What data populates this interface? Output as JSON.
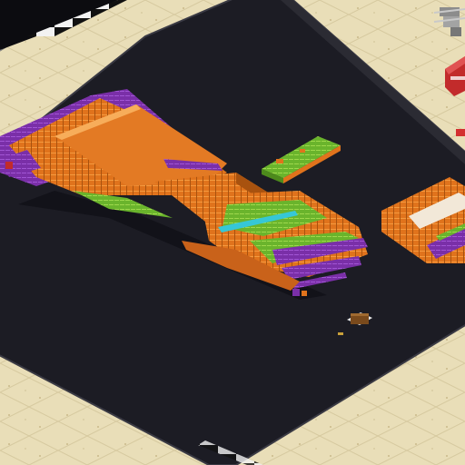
{
  "scene": {
    "view": "isometric",
    "colors": {
      "sand": "#e9deb8",
      "sand_grid": "#cfc298",
      "floor": "#1c1c24",
      "floor_edge": "#3a3a44",
      "orange": "#e0731c",
      "orange_dark": "#a8520f",
      "orange_light": "#f49a3f",
      "purple": "#7a2fa8",
      "green": "#6ab42c",
      "green_light": "#9ed84c",
      "cyan": "#36c7d6",
      "shadow": "#111117",
      "red": "#c22b2b",
      "steel": "#9a9a9a",
      "white": "#f2f2f2"
    },
    "objects": [
      {
        "name": "main-voxel-structure",
        "color": "orange"
      },
      {
        "name": "green-floating-platform",
        "color": "green"
      },
      {
        "name": "right-orange-structure",
        "color": "orange"
      },
      {
        "name": "red-object",
        "color": "red"
      },
      {
        "name": "gray-machine",
        "color": "steel"
      },
      {
        "name": "checkered-floor",
        "color": "white"
      },
      {
        "name": "small-crate",
        "color": "orange_dark"
      }
    ]
  }
}
